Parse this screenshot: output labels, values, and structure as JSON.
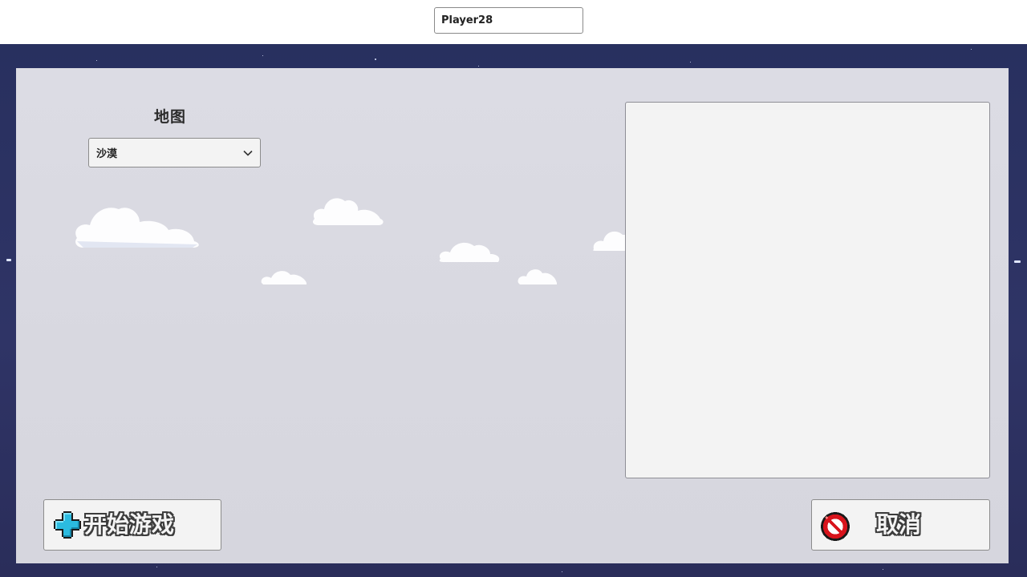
{
  "header": {
    "player_name_value": "Player28"
  },
  "map_section": {
    "label": "地图",
    "selected_map": "沙漠"
  },
  "actions": {
    "start_label": "开始游戏",
    "cancel_label": "取消"
  },
  "icons": {
    "dropdown": "chevron-down-icon",
    "start": "dpad-plus-icon",
    "cancel": "no-entry-icon"
  },
  "colors": {
    "background_sky": "#2a2f5e",
    "panel": "#d8d8e0",
    "start_icon": "#29b6d8",
    "cancel_icon": "#d8141c"
  }
}
